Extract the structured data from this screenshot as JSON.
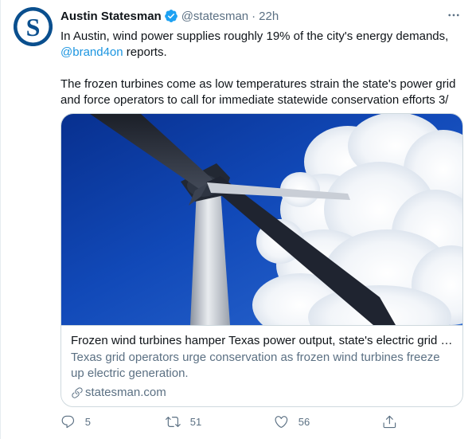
{
  "author": {
    "display_name": "Austin Statesman",
    "handle": "@statesman",
    "separator": "·",
    "time": "22h",
    "avatar_letter": "S"
  },
  "body": {
    "p1_before": "In Austin, wind power supplies roughly 19% of the city's energy demands,",
    "p1_mention": "@brand4on",
    "p1_after": " reports.",
    "p2": "The frozen turbines come as low temperatures strain the state's power grid and force operators to call for immediate statewide conservation efforts 3/"
  },
  "card": {
    "title": "Frozen wind turbines hamper Texas power output, state's electric grid o...",
    "description": "Texas grid operators urge conservation as frozen wind turbines freeze up electric generation.",
    "domain": "statesman.com"
  },
  "actions": {
    "replies": "5",
    "retweets": "51",
    "likes": "56"
  },
  "icons": {
    "verified": "verified-badge-icon",
    "more": "more-icon",
    "reply": "reply-icon",
    "retweet": "retweet-icon",
    "like": "heart-icon",
    "share": "share-icon",
    "link": "link-icon"
  },
  "colors": {
    "link_blue": "#1b95e0",
    "secondary_text": "#5b7083",
    "verified_blue": "#1da1f2",
    "avatar_blue": "#0a4f8e"
  }
}
